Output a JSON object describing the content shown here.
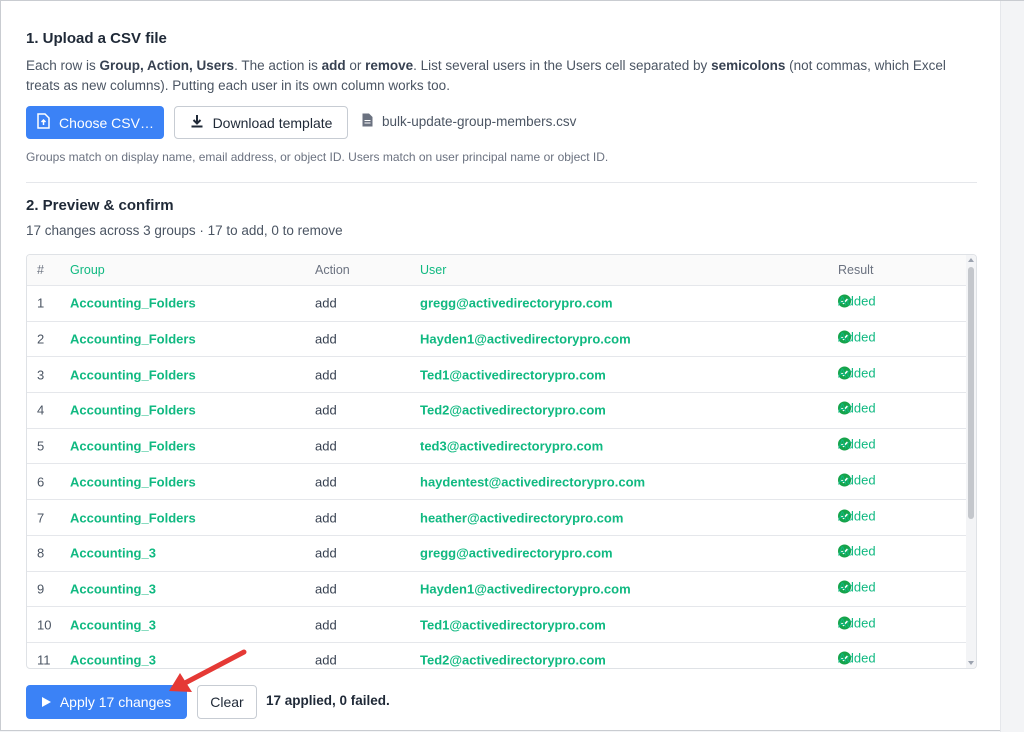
{
  "upload": {
    "title": "1. Upload a CSV file",
    "desc_1": "Each row is ",
    "desc_cols": "Group, Action, Users",
    "desc_2": ". The action is ",
    "desc_add": "add",
    "desc_3": " or ",
    "desc_remove": "remove",
    "desc_4": ". List several users in the Users cell separated by ",
    "desc_semicolons": "semicolons",
    "desc_5": " (not commas, which Excel treats as new columns). Putting each user in its own column works too.",
    "choose_label": "Choose CSV…",
    "download_label": "Download template",
    "file_name": "bulk-update-group-members.csv",
    "hint": "Groups match on display name, email address, or object ID. Users match on user principal name or object ID."
  },
  "preview": {
    "title": "2. Preview & confirm",
    "summary": "17 changes across 3 groups · 17 to add, 0 to remove",
    "columns": [
      "#",
      "Group",
      "Action",
      "User",
      "Result"
    ],
    "rows": [
      {
        "num": "1",
        "group": "Accounting_Folders",
        "action": "add",
        "user": "gregg@activedirectorypro.com",
        "result": "Added"
      },
      {
        "num": "2",
        "group": "Accounting_Folders",
        "action": "add",
        "user": "Hayden1@activedirectorypro.com",
        "result": "Added"
      },
      {
        "num": "3",
        "group": "Accounting_Folders",
        "action": "add",
        "user": "Ted1@activedirectorypro.com",
        "result": "Added"
      },
      {
        "num": "4",
        "group": "Accounting_Folders",
        "action": "add",
        "user": "Ted2@activedirectorypro.com",
        "result": "Added"
      },
      {
        "num": "5",
        "group": "Accounting_Folders",
        "action": "add",
        "user": "ted3@activedirectorypro.com",
        "result": "Added"
      },
      {
        "num": "6",
        "group": "Accounting_Folders",
        "action": "add",
        "user": "haydentest@activedirectorypro.com",
        "result": "Added"
      },
      {
        "num": "7",
        "group": "Accounting_Folders",
        "action": "add",
        "user": "heather@activedirectorypro.com",
        "result": "Added"
      },
      {
        "num": "8",
        "group": "Accounting_3",
        "action": "add",
        "user": "gregg@activedirectorypro.com",
        "result": "Added"
      },
      {
        "num": "9",
        "group": "Accounting_3",
        "action": "add",
        "user": "Hayden1@activedirectorypro.com",
        "result": "Added"
      },
      {
        "num": "10",
        "group": "Accounting_3",
        "action": "add",
        "user": "Ted1@activedirectorypro.com",
        "result": "Added"
      },
      {
        "num": "11",
        "group": "Accounting_3",
        "action": "add",
        "user": "Ted2@activedirectorypro.com",
        "result": "Added"
      }
    ]
  },
  "actions": {
    "apply_label": "Apply 17 changes",
    "clear_label": "Clear",
    "status": "17 applied, 0 failed."
  },
  "colors": {
    "primary": "#3b82f6",
    "success": "#16a34a",
    "link_green": "#10b981",
    "annotation_arrow": "#e53935"
  },
  "icons": {
    "choose": "upload-file-icon",
    "download": "download-icon",
    "file": "document-icon",
    "result": "check-circle-icon",
    "apply": "play-icon"
  }
}
